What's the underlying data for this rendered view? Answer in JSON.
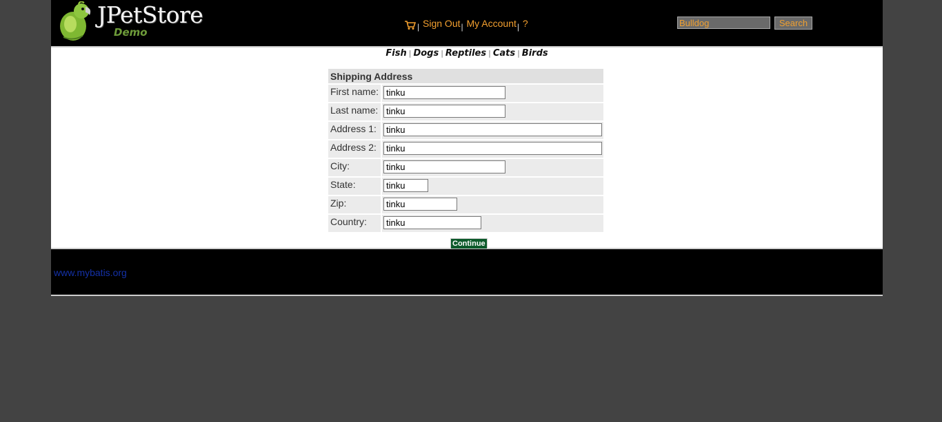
{
  "header": {
    "logo_title": "JPetStore",
    "logo_subtitle": "Demo",
    "cart_icon": "shopping-cart-icon",
    "menu": {
      "sign_out": "Sign Out",
      "my_account": "My Account",
      "help": "?",
      "separator": "|"
    },
    "search": {
      "value": "Bulldog",
      "button": "Search"
    }
  },
  "quick_links": {
    "fish": "Fish",
    "dogs": "Dogs",
    "reptiles": "Reptiles",
    "cats": "Cats",
    "birds": "Birds",
    "separator": "|"
  },
  "shipping": {
    "heading": "Shipping Address",
    "fields": {
      "first_name": {
        "label": "First name:",
        "value": "tinku"
      },
      "last_name": {
        "label": "Last name:",
        "value": "tinku"
      },
      "address1": {
        "label": "Address 1:",
        "value": "tinku"
      },
      "address2": {
        "label": "Address 2:",
        "value": "tinku"
      },
      "city": {
        "label": "City:",
        "value": "tinku"
      },
      "state": {
        "label": "State:",
        "value": "tinku"
      },
      "zip": {
        "label": "Zip:",
        "value": "tinku"
      },
      "country": {
        "label": "Country:",
        "value": "tinku"
      }
    },
    "continue_button": "Continue"
  },
  "footer": {
    "link": "www.mybatis.org"
  },
  "colors": {
    "page_background": "#434343",
    "header_background": "#000000",
    "menu_link": "#f4a02f",
    "footer_link": "#1431a8",
    "continue_button": "#0c5a2a"
  }
}
